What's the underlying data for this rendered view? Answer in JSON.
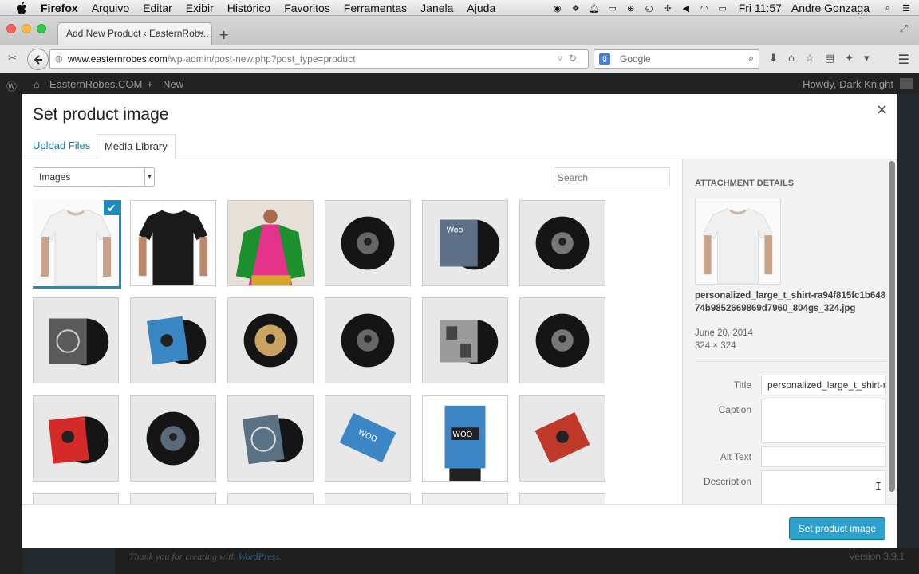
{
  "menubar": {
    "app": "Firefox",
    "items": [
      "Arquivo",
      "Editar",
      "Exibir",
      "Histórico",
      "Favoritos",
      "Ferramentas",
      "Janela",
      "Ajuda"
    ],
    "clock": "Fri 11:57",
    "user": "Andre Gonzaga"
  },
  "browser": {
    "tab_title": "Add New Product ‹ EasternRob…",
    "url_domain": "www.easternrobes.com",
    "url_path": "/wp-admin/post-new.php?post_type=product",
    "search_placeholder": "Google"
  },
  "adminbar": {
    "site": "EasternRobes.COM",
    "new": "New",
    "howdy": "Howdy, Dark Knight"
  },
  "footer": {
    "thanks": "Thank you for creating with ",
    "wp_link": "WordPress",
    "dot": ".",
    "version": "Version 3.9.1"
  },
  "modal": {
    "title": "Set product image",
    "tabs": {
      "upload": "Upload Files",
      "library": "Media Library"
    },
    "filter": "Images",
    "search_placeholder": "Search",
    "set_button": "Set product image"
  },
  "details": {
    "heading": "ATTACHMENT DETAILS",
    "filename": "personalized_large_t_shirt-ra94f815fc1b64874b9852669869d7960_804gs_324.jpg",
    "date": "June 20, 2014",
    "dimensions": "324 × 324",
    "title_label": "Title",
    "title_value": "personalized_large_t_shirt-ra",
    "caption_label": "Caption",
    "alt_label": "Alt Text",
    "description_label": "Description"
  },
  "colors": {
    "accent": "#2ea2cc",
    "link": "#21759b",
    "selected_border": "#1e8cbe"
  }
}
